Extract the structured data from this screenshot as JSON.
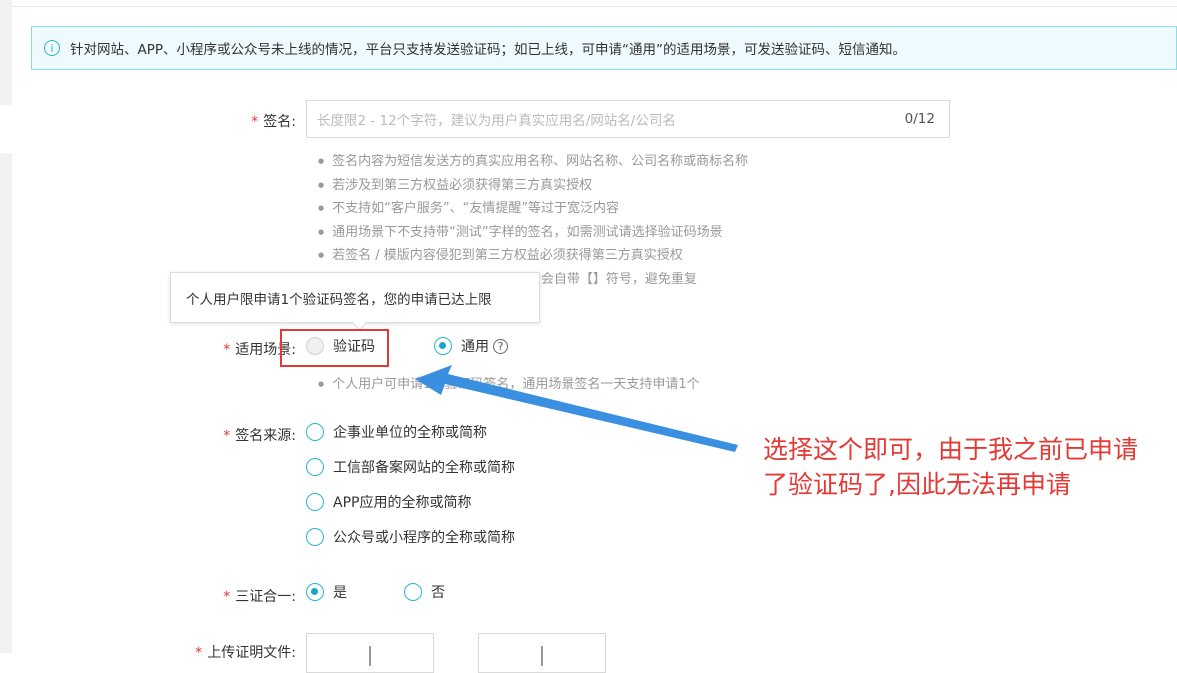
{
  "notice": {
    "text": "针对网站、APP、小程序或公众号未上线的情况，平台只支持发送验证码；如已上线，可申请“通用”的适用场景，可发送验证码、短信通知。"
  },
  "form": {
    "signature": {
      "label": "签名:",
      "placeholder": "长度限2 - 12个字符，建议为用户真实应用名/网站名/公司名",
      "counter": "0/12",
      "tips": [
        "签名内容为短信发送方的真实应用名称、网站名称、公司名称或商标名称",
        "若涉及到第三方权益必须获得第三方真实授权",
        "不支持如“客户服务”、“友情提醒”等过于宽泛内容",
        "通用场景下不支持带“测试”字样的签名，如需测试请选择验证码场景",
        "若签名 / 模版内容侵犯到第三方权益必须获得第三方真实授权",
        "无须添加【】、()、[]符号，签名发送会自带【】符号，避免重复"
      ]
    },
    "scene": {
      "label": "适用场景:",
      "options": [
        {
          "label": "验证码",
          "state": "disabled"
        },
        {
          "label": "通用",
          "state": "checked"
        }
      ],
      "help_glyph": "?",
      "tip": "个人用户可申请1个验证码签名，通用场景签名一天支持申请1个"
    },
    "source": {
      "label": "签名来源:",
      "options": [
        "企事业单位的全称或简称",
        "工信部备案网站的全称或简称",
        "APP应用的全称或简称",
        "公众号或小程序的全称或简称"
      ]
    },
    "three_in_one": {
      "label": "三证合一:",
      "yes": "是",
      "no": "否"
    },
    "upload": {
      "label": "上传证明文件:"
    }
  },
  "tooltip": {
    "text": "个人用户限申请1个验证码签名，您的申请已达上限"
  },
  "annotation": {
    "line1": "选择这个即可，由于我之前已申请",
    "line2": "了验证码了,因此无法再申请",
    "color": "#e53935"
  },
  "colors": {
    "accent": "#1aa6c6",
    "required": "#e4393c",
    "arrow": "#3a8fe0"
  }
}
